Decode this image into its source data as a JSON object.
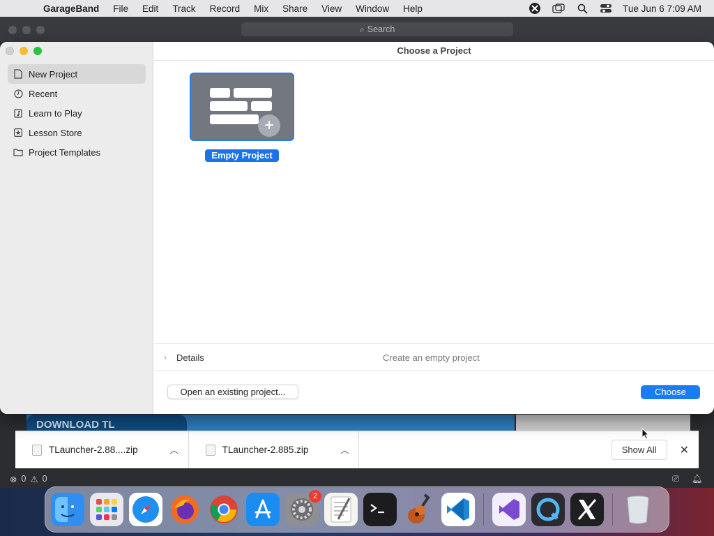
{
  "menubar": {
    "app_name": "GarageBand",
    "items": [
      "File",
      "Edit",
      "Track",
      "Record",
      "Mix",
      "Share",
      "View",
      "Window",
      "Help"
    ],
    "datetime": "Tue Jun 6  7:09 AM"
  },
  "background_window": {
    "search_placeholder": "Search",
    "banner_text": "DOWNLOAD TL"
  },
  "dialog": {
    "title": "Choose a Project",
    "sidebar": [
      {
        "label": "New Project",
        "icon": "document-icon",
        "selected": true
      },
      {
        "label": "Recent",
        "icon": "clock-icon"
      },
      {
        "label": "Learn to Play",
        "icon": "music-note-icon"
      },
      {
        "label": "Lesson Store",
        "icon": "star-icon"
      },
      {
        "label": "Project Templates",
        "icon": "folder-icon"
      }
    ],
    "project": {
      "label": "Empty Project"
    },
    "details_label": "Details",
    "details_description": "Create an empty project",
    "open_button": "Open an existing project...",
    "choose_button": "Choose"
  },
  "downloads": {
    "items": [
      {
        "name": "TLauncher-2.88....zip"
      },
      {
        "name": "TLauncher-2.885.zip"
      }
    ],
    "show_all": "Show All"
  },
  "statusbar": {
    "errors": "0",
    "warnings": "0"
  },
  "dock": {
    "apps": [
      {
        "name": "finder-icon",
        "color": "#2f8ef0"
      },
      {
        "name": "launchpad-icon",
        "color": "#e8e8ee"
      },
      {
        "name": "safari-icon",
        "color": "#1f8ff0"
      },
      {
        "name": "firefox-icon",
        "color": "#f26b1e"
      },
      {
        "name": "chrome-icon",
        "color": "#ffffff"
      },
      {
        "name": "app-store-icon",
        "color": "#1b8cf2"
      },
      {
        "name": "system-settings-icon",
        "color": "#8e8e93",
        "badge": "2"
      },
      {
        "name": "textedit-icon",
        "color": "#f5f5f0"
      },
      {
        "name": "terminal-icon",
        "color": "#1c1c1e"
      },
      {
        "name": "garageband-icon",
        "color": "#7a3b1c"
      },
      {
        "name": "vscode-icon",
        "color": "#ffffff"
      },
      {
        "name": "visual-studio-icon",
        "color": "#f3eefb"
      },
      {
        "name": "quicktime-icon",
        "color": "#2a2a30"
      },
      {
        "name": "x-app-icon",
        "color": "#1f1f22"
      },
      {
        "name": "trash-icon",
        "color": "#d8dde3"
      }
    ]
  }
}
